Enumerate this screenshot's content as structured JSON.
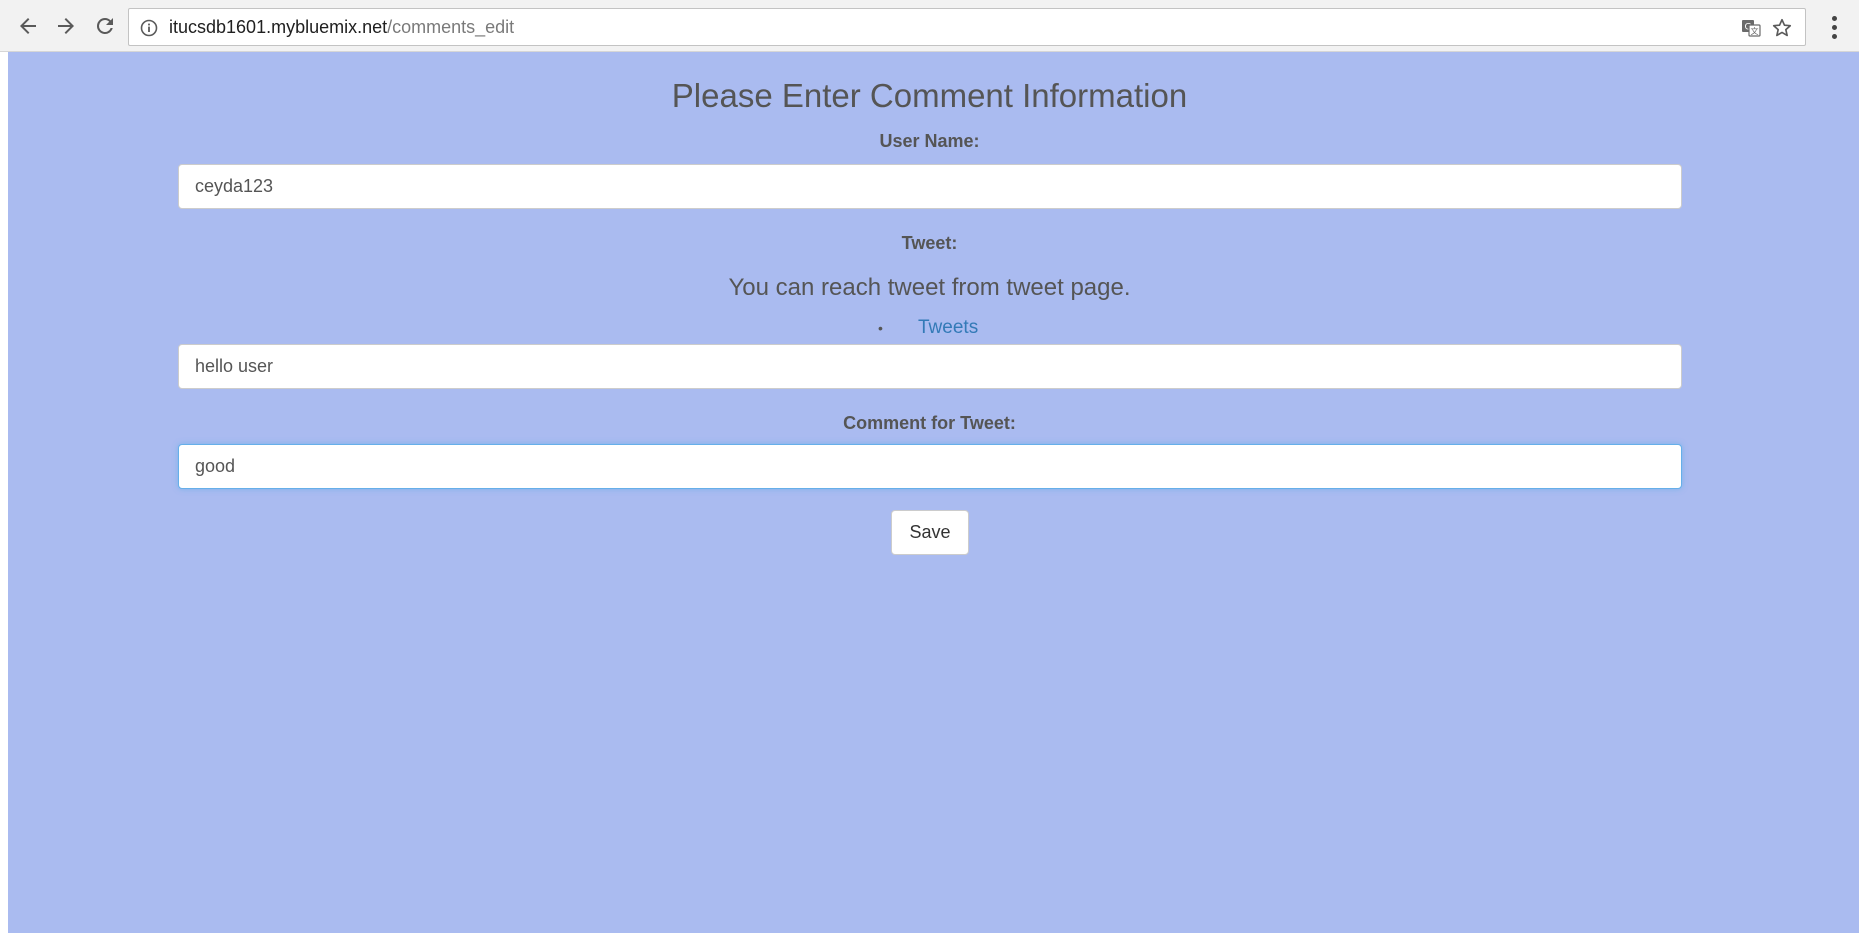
{
  "browser": {
    "url_host": "itucsdb1601.mybluemix.net",
    "url_path": "/comments_edit",
    "icons": {
      "back": "arrow-left-icon",
      "forward": "arrow-right-icon",
      "reload": "reload-icon",
      "site_info": "info-icon",
      "translate": "translate-icon",
      "bookmark": "star-icon",
      "menu": "kebab-menu-icon"
    }
  },
  "page": {
    "background_color": "#aabbf0",
    "title": "Please Enter Comment Information",
    "username_label": "User Name:",
    "username_value": "ceyda123",
    "tweet_label": "Tweet:",
    "tweet_hint": "You can reach tweet from tweet page.",
    "tweets_link": "Tweets",
    "tweet_value": "hello user",
    "comment_label": "Comment for Tweet:",
    "comment_value": "good",
    "save_label": "Save",
    "link_color": "#337ab7",
    "focus_color": "#66afe9"
  }
}
